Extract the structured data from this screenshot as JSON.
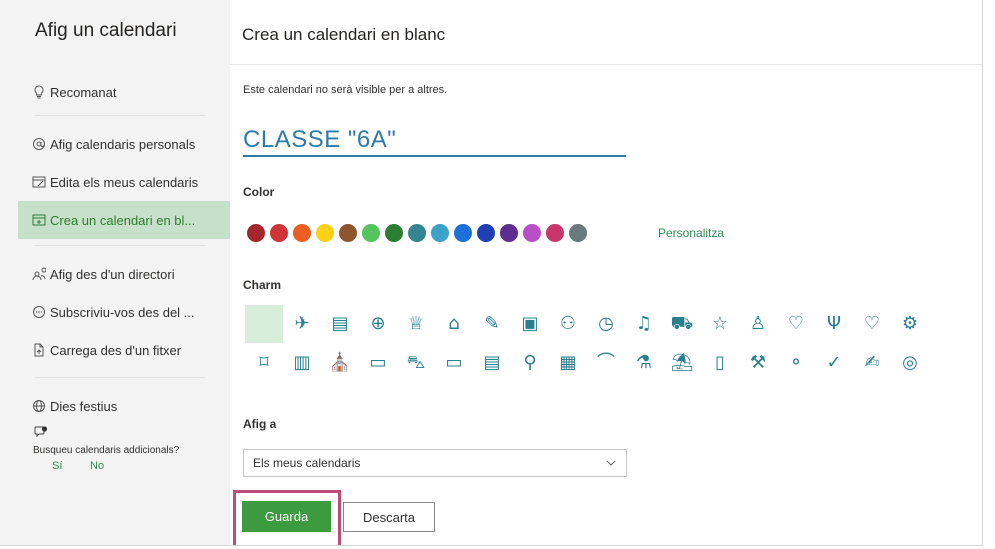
{
  "sidebar": {
    "title": "Afig un calendari",
    "items": [
      {
        "label": "Recomanat",
        "icon": "lightbulb-icon"
      },
      {
        "label": "Afig calendaris personals",
        "icon": "at-icon"
      },
      {
        "label": "Edita els meus calendaris",
        "icon": "edit-calendar-icon"
      },
      {
        "label": "Crea un calendari en bl...",
        "icon": "calendar-add-icon"
      },
      {
        "label": "Afig des d'un directori",
        "icon": "people-search-icon"
      },
      {
        "label": "Subscriviu-vos des del ...",
        "icon": "subscribe-icon"
      },
      {
        "label": "Carrega des d'un fitxer",
        "icon": "file-upload-icon"
      },
      {
        "label": "Dies festius",
        "icon": "globe-icon"
      }
    ],
    "prompt": {
      "text": "Busqueu calendaris addicionals?",
      "yes": "Sí",
      "no": "No"
    }
  },
  "main": {
    "title": "Crea un calendari en blanc",
    "notice": "Este calendari no serà visible per a altres.",
    "name_value": "CLASSE \"6A\"",
    "color_label": "Color",
    "customize_label": "Personalitza",
    "charm_label": "Charm",
    "add_label": "Afig a",
    "add_value": "Els meus calendaris",
    "save_label": "Guarda",
    "discard_label": "Descarta"
  },
  "colors": [
    "#a4262c",
    "#d13438",
    "#ea5f1f",
    "#fcd116",
    "#8e562e",
    "#54c45e",
    "#2d7d32",
    "#33858f",
    "#3ca2c8",
    "#1d6fd9",
    "#1f3fb2",
    "#5e2d91",
    "#b94fc6",
    "#c8366a",
    "#69797e"
  ],
  "charms_row1": [
    "",
    "✈",
    "▤",
    "⊕",
    "♕",
    "⌂",
    "✎",
    "▣",
    "⚇",
    "◷",
    "♫",
    "⛟",
    "☆",
    "♙",
    "♡",
    "Ψ",
    "♡",
    "⚙"
  ],
  "charms_row2": [
    "⌑",
    "▥",
    "⛪",
    "▭",
    "⛍",
    "▭",
    "▤",
    "⚲",
    "▦",
    "⌒",
    "⚗",
    "⛱",
    "▯",
    "⚒",
    "⚬",
    "✓",
    "✍",
    "◎"
  ],
  "accent": "#3c9a3f",
  "link_color": "#2e8b57",
  "title_color": "#2e7aa8"
}
